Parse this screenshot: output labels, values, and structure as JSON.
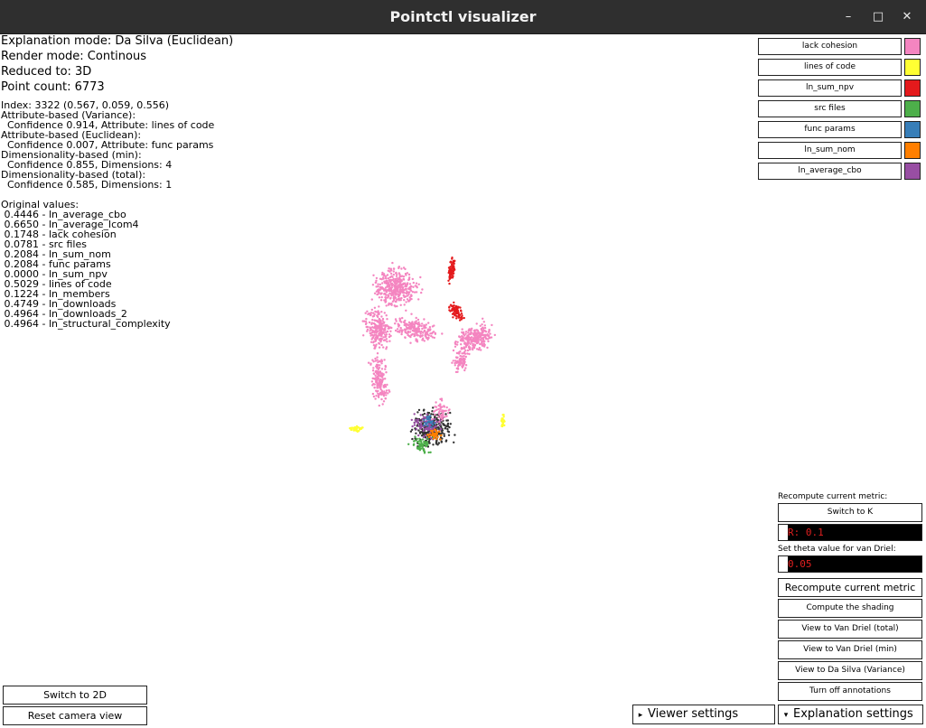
{
  "window": {
    "title": "Pointctl visualizer",
    "minimize": "–",
    "maximize": "□",
    "close": "✕"
  },
  "info": {
    "explanation_mode": "Explanation mode: Da Silva (Euclidean)",
    "render_mode": "Render mode: Continous",
    "reduced_to": "Reduced to: 3D",
    "point_count": "Point count: 6773"
  },
  "selection": {
    "index": "Index: 3322 (0.567, 0.059, 0.556)",
    "lines": [
      "Attribute-based (Variance):",
      "  Confidence 0.914, Attribute: lines of code",
      "Attribute-based (Euclidean):",
      "  Confidence 0.007, Attribute: func params",
      "Dimensionality-based (min):",
      "  Confidence 0.855, Dimensions: 4",
      "Dimensionality-based (total):",
      "  Confidence 0.585, Dimensions: 1"
    ]
  },
  "original_values": {
    "header": "Original values:",
    "items": [
      " 0.4446 - ln_average_cbo",
      " 0.6650 - ln_average_lcom4",
      " 0.1748 - lack cohesion",
      " 0.0781 - src files",
      " 0.2084 - ln_sum_nom",
      " 0.2084 - func params",
      " 0.0000 - ln_sum_npv",
      " 0.5029 - lines of code",
      " 0.1224 - ln_members",
      " 0.4749 - ln_downloads",
      " 0.4964 - ln_downloads_2",
      " 0.4964 - ln_structural_complexity"
    ]
  },
  "legend": [
    {
      "label": "lack cohesion",
      "color": "#f485c0"
    },
    {
      "label": "lines of code",
      "color": "#ffff33"
    },
    {
      "label": "ln_sum_npv",
      "color": "#e41a1c"
    },
    {
      "label": "src files",
      "color": "#4daf4a"
    },
    {
      "label": "func params",
      "color": "#377eb8"
    },
    {
      "label": "ln_sum_nom",
      "color": "#ff7f00"
    },
    {
      "label": "ln_average_cbo",
      "color": "#984ea3"
    }
  ],
  "right_panel": {
    "recompute_label": "Recompute current metric:",
    "switch_k": "Switch to K",
    "k_field_value": "R: 0.1",
    "theta_label": "Set theta value for van Driel:",
    "theta_value": "0.05",
    "recompute_button": "Recompute current metric",
    "compute_shading": "Compute the shading",
    "view_van_driel_total": "View to Van Driel (total)",
    "view_van_driel_min": "View to Van Driel (min)",
    "view_da_silva_variance": "View to Da Silva (Variance)",
    "turn_off_annotations": "Turn off annotations"
  },
  "bottom": {
    "switch_2d": "Switch to 2D",
    "reset_camera": "Reset camera view",
    "viewer_settings": "Viewer settings",
    "viewer_settings_arrow": "▸",
    "explanation_settings": "Explanation settings",
    "explanation_settings_arrow": "▾"
  }
}
